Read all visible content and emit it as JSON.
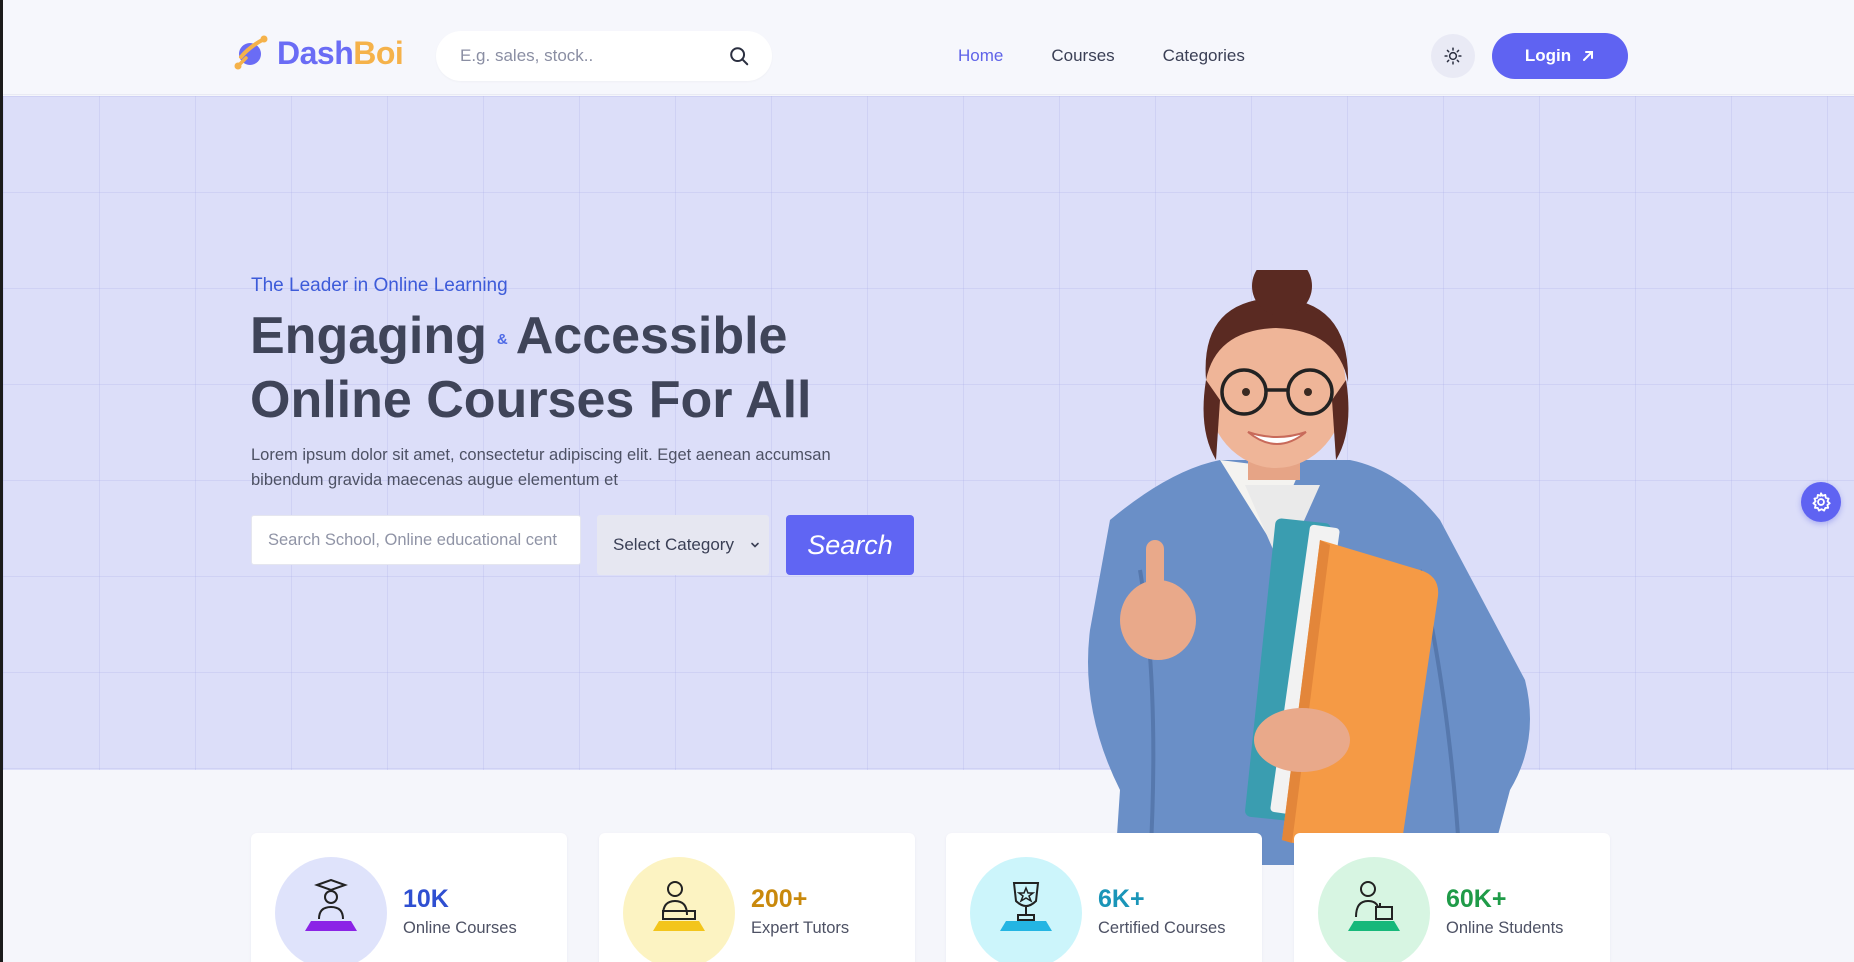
{
  "brand": {
    "name_part1": "Dash",
    "name_part2": "Boi",
    "color_primary": "#6a6cf5",
    "color_accent": "#f5b24a"
  },
  "header": {
    "search_placeholder": "E.g. sales, stock..",
    "nav": [
      {
        "label": "Home",
        "active": true
      },
      {
        "label": "Courses",
        "active": false
      },
      {
        "label": "Categories",
        "active": false
      }
    ],
    "theme_toggle_icon": "sun-icon",
    "login_label": "Login"
  },
  "hero": {
    "eyebrow": "The Leader in Online Learning",
    "headline_part1": "Engaging",
    "headline_amp": "&",
    "headline_part2": "Accessible",
    "headline_line2": "Online Courses For All",
    "description": "Lorem ipsum dolor sit amet, consectetur adipiscing elit. Eget aenean accumsan bibendum gravida maecenas augue elementum et",
    "search_placeholder": "Search School, Online educational cent",
    "category_select_value": "Select Category",
    "search_button_label": "Search"
  },
  "stats": [
    {
      "value": "10K",
      "label": "Online Courses",
      "icon": "graduate-icon",
      "value_color": "#2f4fd1",
      "circle_bg": "#dfe3fb",
      "stand_color": "#8b24e6"
    },
    {
      "value": "200+",
      "label": "Expert Tutors",
      "icon": "tutor-icon",
      "value_color": "#c9890c",
      "circle_bg": "#fcf3c2",
      "stand_color": "#f3c51b"
    },
    {
      "value": "6K+",
      "label": "Certified Courses",
      "icon": "trophy-icon",
      "value_color": "#1a95b8",
      "circle_bg": "#ccf5fb",
      "stand_color": "#24b5e3"
    },
    {
      "value": "60K+",
      "label": "Online Students",
      "icon": "student-icon",
      "value_color": "#1f9b48",
      "circle_bg": "#d7f5e2",
      "stand_color": "#16b87a"
    }
  ],
  "colors": {
    "primary": "#5f63f2",
    "hero_bg": "#dcdef9"
  }
}
